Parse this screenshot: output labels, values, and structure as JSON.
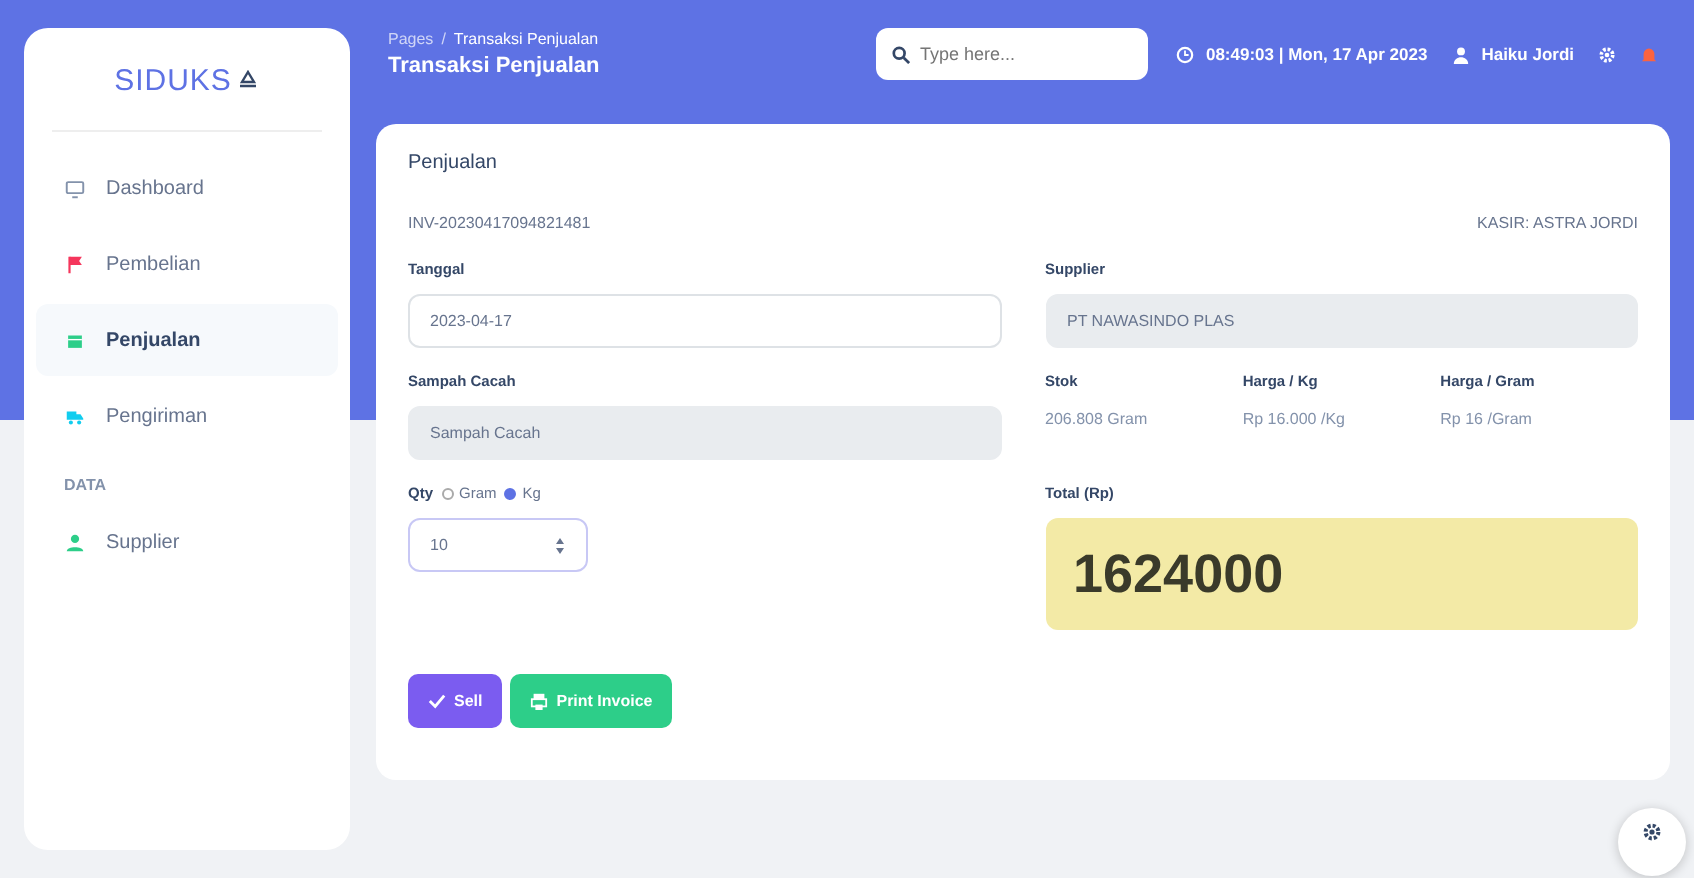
{
  "sidebar": {
    "logo": "SIDUKS",
    "items": [
      {
        "kind": "link",
        "label": "Dashboard",
        "color": "#8392ab",
        "selected": false
      },
      {
        "kind": "link",
        "label": "Pembelian",
        "color": "#f5365c",
        "selected": false
      },
      {
        "kind": "link",
        "label": "Penjualan",
        "color": "#2dce89",
        "selected": true
      },
      {
        "kind": "link",
        "label": "Pengiriman",
        "color": "#11cdef",
        "selected": false
      },
      {
        "kind": "heading",
        "label": "DATA"
      },
      {
        "kind": "link",
        "label": "Supplier",
        "color": "#2dce89",
        "selected": false
      }
    ]
  },
  "topbar": {
    "breadcrumb": [
      "Pages",
      "/",
      "Transaksi Penjualan"
    ],
    "title": "Transaksi Penjualan",
    "search": {
      "placeholder": "Type here..."
    },
    "clock": "08:49:03 | Mon, 17 Apr 2023",
    "user": "Haiku Jordi"
  },
  "card": {
    "title": "Penjualan",
    "invoice": "INV-20230417094821481",
    "cashier": "KASIR: ASTRA JORDI",
    "date": {
      "label": "Tanggal",
      "value": "2023-04-17"
    },
    "supplier": {
      "label": "Supplier",
      "value": "PT NAWASINDO PLAS"
    },
    "product": {
      "label": "Sampah Cacah",
      "value": "Sampah Cacah"
    },
    "stats": [
      {
        "label": "Stok",
        "value": "206.808 Gram"
      },
      {
        "label": "Harga / Kg",
        "value": "Rp 16.000 /Kg"
      },
      {
        "label": "Harga / Gram",
        "value": "Rp 16 /Gram"
      }
    ],
    "qty": {
      "label": "Qty",
      "units": [
        {
          "label": "Gram",
          "selected": false
        },
        {
          "label": "Kg",
          "selected": true
        }
      ],
      "value": "10"
    },
    "total": {
      "label": "Total (Rp)",
      "value": "1624000"
    },
    "buttons": [
      {
        "kind": "sell",
        "label": "Sell"
      },
      {
        "kind": "print",
        "label": "Print Invoice"
      }
    ]
  }
}
